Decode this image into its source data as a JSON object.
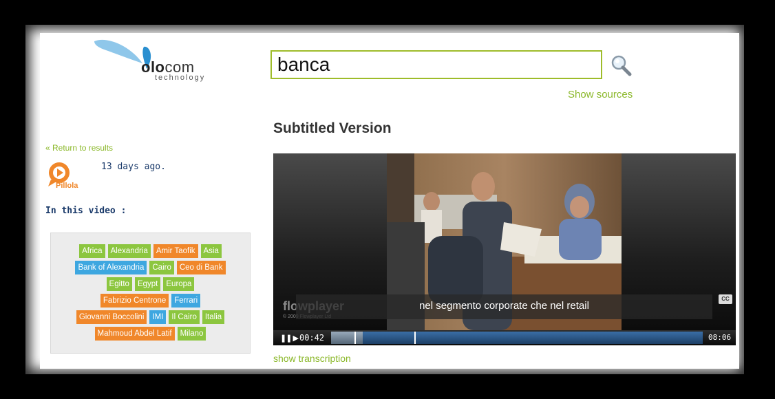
{
  "logo": {
    "word_bold": "olo",
    "word_rest": "com",
    "subtitle": "technology"
  },
  "search": {
    "value": "banca"
  },
  "links": {
    "show_sources": "Show sources",
    "return": "« Return to results",
    "show_transcription": "show transcription"
  },
  "page_title": "Subtitled Version",
  "video_meta": {
    "badge": "Pillola",
    "age": "13 days ago.",
    "in_video_label": "In this video :"
  },
  "tags": [
    {
      "label": "Africa",
      "color": "green"
    },
    {
      "label": "Alexandria",
      "color": "green"
    },
    {
      "label": "Amir Taofik",
      "color": "orange"
    },
    {
      "label": "Asia",
      "color": "green"
    },
    {
      "label": "Bank of Alexandria",
      "color": "blue"
    },
    {
      "label": "Cairo",
      "color": "green"
    },
    {
      "label": "Ceo di Bank",
      "color": "orange"
    },
    {
      "label": "Egitto",
      "color": "green"
    },
    {
      "label": "Egypt",
      "color": "green"
    },
    {
      "label": "Europa",
      "color": "green"
    },
    {
      "label": "Fabrizio Centrone",
      "color": "orange"
    },
    {
      "label": "Ferrari",
      "color": "blue"
    },
    {
      "label": "Giovanni Boccolini",
      "color": "orange"
    },
    {
      "label": "IMI",
      "color": "blue"
    },
    {
      "label": "Il Cairo",
      "color": "green"
    },
    {
      "label": "Italia",
      "color": "green"
    },
    {
      "label": "Mahmoud Abdel Latif",
      "color": "orange"
    },
    {
      "label": "Milano",
      "color": "green"
    }
  ],
  "player": {
    "brand": "flowplayer",
    "copyright": "© 2009 Flowplayer Ltd",
    "subtitle": "nel segmento corporate che nel retail",
    "cc_label": "CC",
    "current_time": "00:42",
    "duration": "08:06",
    "progress_fraction": 0.086
  },
  "colors": {
    "accent": "#8bb82a",
    "tag_green": "#8cc63f",
    "tag_orange": "#f0872a",
    "tag_blue": "#3ea7e0"
  }
}
